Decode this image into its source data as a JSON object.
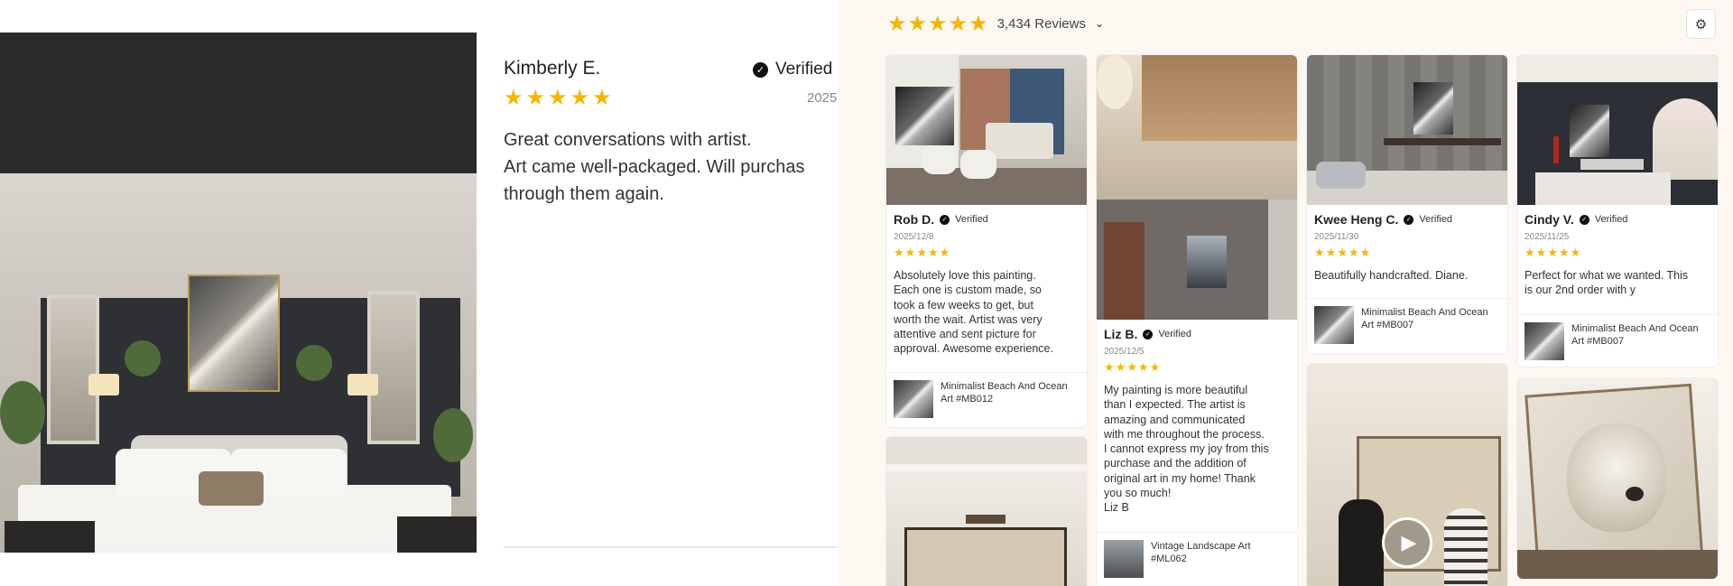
{
  "modal": {
    "reviewer_name": "Kimberly E.",
    "verified_label": "Verified",
    "date": "2025",
    "rating": 5,
    "body_lines": [
      "Great conversations with artist.",
      "Art came well-packaged. Will purchas",
      "through them again."
    ],
    "photo_icon": "bedroom-photo"
  },
  "widget": {
    "summary": {
      "rating": 5,
      "count_text": "3,434 Reviews",
      "chevron_icon": "chevron-down-icon"
    },
    "filter_icon": "sliders-icon",
    "star_color": "#f2b705",
    "cards": [
      {
        "name": "Rob D.",
        "verified": "Verified",
        "date": "2025/12/8",
        "rating": 5,
        "text": "Absolutely love this painting.\nEach one is custom made, so\ntook a few weeks to get, but\nworth the wait. Artist was very\nattentive and sent picture for\napproval.  Awesome experience.",
        "product": "Minimalist Beach And Ocean\nArt #MB012"
      },
      {
        "name": "Liz B.",
        "verified": "Verified",
        "date": "2025/12/5",
        "rating": 5,
        "text": "My painting is more beautiful\nthan I expected.  The artist is\namazing and communicated\nwith me throughout the process.\nI cannot express my joy from this\npurchase and the addition of\noriginal art in my home!  Thank\nyou so much!\nLiz B",
        "product": "Vintage Landscape Art\n#ML062"
      },
      {
        "name": "Kwee Heng C.",
        "verified": "Verified",
        "date": "2025/11/30",
        "rating": 5,
        "text": "Beautifully handcrafted. Diane.",
        "product": "Minimalist Beach And Ocean\nArt #MB007"
      },
      {
        "name": "Cindy V.",
        "verified": "Verified",
        "date": "2025/11/25",
        "rating": 5,
        "text": "Perfect for what we wanted.  This\nis our 2nd order with y",
        "product": "Minimalist Beach And Ocean\nArt #MB007"
      }
    ],
    "play_icon": "play-icon"
  }
}
